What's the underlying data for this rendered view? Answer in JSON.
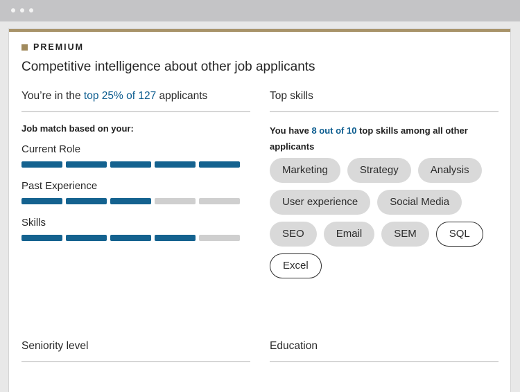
{
  "premium_label": "PREMIUM",
  "headline": "Competitive intelligence about other job applicants",
  "ranking": {
    "prefix": "You’re in the ",
    "highlight": "top 25% of 127",
    "suffix": " applicants"
  },
  "match_heading": "Job match based on your:",
  "metrics": [
    {
      "label": "Current Role",
      "filled": 5,
      "total": 5
    },
    {
      "label": "Past Experience",
      "filled": 3,
      "total": 5
    },
    {
      "label": "Skills",
      "filled": 4,
      "total": 5
    }
  ],
  "top_skills": {
    "heading": "Top skills",
    "prefix": "You have ",
    "highlight": "8 out of 10",
    "suffix": " top skills among all other applicants",
    "chips": [
      {
        "label": "Marketing",
        "matched": true
      },
      {
        "label": "Strategy",
        "matched": true
      },
      {
        "label": "Analysis",
        "matched": true
      },
      {
        "label": "User experience",
        "matched": true
      },
      {
        "label": "Social Media",
        "matched": true
      },
      {
        "label": "SEO",
        "matched": true
      },
      {
        "label": "Email",
        "matched": true
      },
      {
        "label": "SEM",
        "matched": true
      },
      {
        "label": "SQL",
        "matched": false
      },
      {
        "label": "Excel",
        "matched": false
      }
    ]
  },
  "seniority_heading": "Seniority level",
  "education_heading": "Education",
  "colors": {
    "accent": "#14628f",
    "highlight_text": "#0b5c8f",
    "premium_gold": "#a89369",
    "bar_empty": "#cfcfcf"
  }
}
